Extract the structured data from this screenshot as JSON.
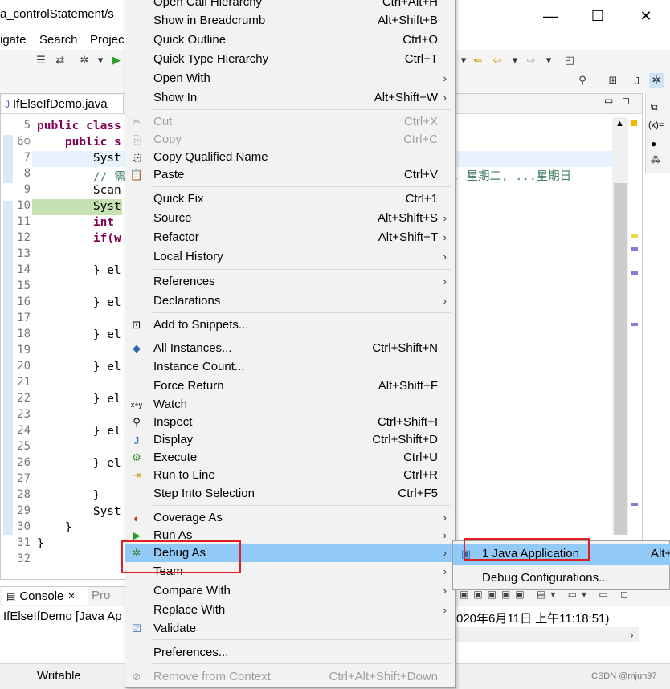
{
  "window": {
    "title": "a_controlStatement/s",
    "minimize": "—",
    "maximize": "☐",
    "close": "✕"
  },
  "menubar": [
    "igate",
    "Search",
    "Projec"
  ],
  "editor": {
    "tab_label": "IfElseIfDemo.java",
    "lines": [
      {
        "no": "5",
        "code": "public class"
      },
      {
        "no": "6⊖",
        "code": "    public s"
      },
      {
        "no": "7",
        "code": "        Syst"
      },
      {
        "no": "8",
        "code": "        // 需"
      },
      {
        "no": "9",
        "code": "        Scan"
      },
      {
        "no": "10",
        "code": "        Syst"
      },
      {
        "no": "11",
        "code": "        int"
      },
      {
        "no": "12",
        "code": "        if(w"
      },
      {
        "no": "13",
        "code": ""
      },
      {
        "no": "14",
        "code": "        } el"
      },
      {
        "no": "15",
        "code": ""
      },
      {
        "no": "16",
        "code": "        } el"
      },
      {
        "no": "17",
        "code": ""
      },
      {
        "no": "18",
        "code": "        } el"
      },
      {
        "no": "19",
        "code": ""
      },
      {
        "no": "20",
        "code": "        } el"
      },
      {
        "no": "21",
        "code": ""
      },
      {
        "no": "22",
        "code": "        } el"
      },
      {
        "no": "23",
        "code": ""
      },
      {
        "no": "24",
        "code": "        } el"
      },
      {
        "no": "25",
        "code": ""
      },
      {
        "no": "26",
        "code": "        } el"
      },
      {
        "no": "27",
        "code": ""
      },
      {
        "no": "28",
        "code": "        }"
      },
      {
        "no": "29",
        "code": "        Syst"
      },
      {
        "no": "30",
        "code": "    }"
      },
      {
        "no": "31",
        "code": "}"
      },
      {
        "no": "32",
        "code": ""
      }
    ],
    "line8_tail": "期一, 星期二, ...星期日"
  },
  "console": {
    "tab_label": "Console",
    "tab_close": "✕",
    "second_tab": "Pro",
    "text_left": "IfElseIfDemo [Java Ap",
    "text_right": "020年6月11日 上午11:18:51)"
  },
  "status": {
    "writable": "Writable"
  },
  "watermark": "CSDN @mjun97",
  "context_menu": {
    "items": [
      {
        "label": "Open Call Hierarchy",
        "accel": "Ctrl+Alt+H"
      },
      {
        "label": "Show in Breadcrumb",
        "accel": "Alt+Shift+B"
      },
      {
        "label": "Quick Outline",
        "accel": "Ctrl+O"
      },
      {
        "label": "Quick Type Hierarchy",
        "accel": "Ctrl+T"
      },
      {
        "label": "Open With",
        "accel": ""
      },
      {
        "label": "Show In",
        "accel": "Alt+Shift+W"
      },
      {
        "label": "Cut",
        "accel": "Ctrl+X"
      },
      {
        "label": "Copy",
        "accel": "Ctrl+C"
      },
      {
        "label": "Copy Qualified Name",
        "accel": ""
      },
      {
        "label": "Paste",
        "accel": "Ctrl+V"
      },
      {
        "label": "Quick Fix",
        "accel": "Ctrl+1"
      },
      {
        "label": "Source",
        "accel": "Alt+Shift+S"
      },
      {
        "label": "Refactor",
        "accel": "Alt+Shift+T"
      },
      {
        "label": "Local History",
        "accel": ""
      },
      {
        "label": "References",
        "accel": ""
      },
      {
        "label": "Declarations",
        "accel": ""
      },
      {
        "label": "Add to Snippets...",
        "accel": ""
      },
      {
        "label": "All Instances...",
        "accel": "Ctrl+Shift+N"
      },
      {
        "label": "Instance Count...",
        "accel": ""
      },
      {
        "label": "Force Return",
        "accel": "Alt+Shift+F"
      },
      {
        "label": "Watch",
        "accel": ""
      },
      {
        "label": "Inspect",
        "accel": "Ctrl+Shift+I"
      },
      {
        "label": "Display",
        "accel": "Ctrl+Shift+D"
      },
      {
        "label": "Execute",
        "accel": "Ctrl+U"
      },
      {
        "label": "Run to Line",
        "accel": "Ctrl+R"
      },
      {
        "label": "Step Into Selection",
        "accel": "Ctrl+F5"
      },
      {
        "label": "Coverage As",
        "accel": ""
      },
      {
        "label": "Run As",
        "accel": ""
      },
      {
        "label": "Debug As",
        "accel": ""
      },
      {
        "label": "Team",
        "accel": ""
      },
      {
        "label": "Compare With",
        "accel": ""
      },
      {
        "label": "Replace With",
        "accel": ""
      },
      {
        "label": "Validate",
        "accel": ""
      },
      {
        "label": "Preferences...",
        "accel": ""
      },
      {
        "label": "Remove from Context",
        "accel": "Ctrl+Alt+Shift+Down"
      }
    ]
  },
  "submenu": {
    "items": [
      {
        "label": "1 Java Application",
        "accel": "Alt+"
      },
      {
        "label": "Debug Configurations...",
        "accel": ""
      }
    ]
  },
  "colors": {
    "menu_bg": "#f2f2f2",
    "highlight": "#91c9f7",
    "annotation_red": "#e02020",
    "keyword": "#7f0055",
    "comment": "#3f7f5f"
  }
}
